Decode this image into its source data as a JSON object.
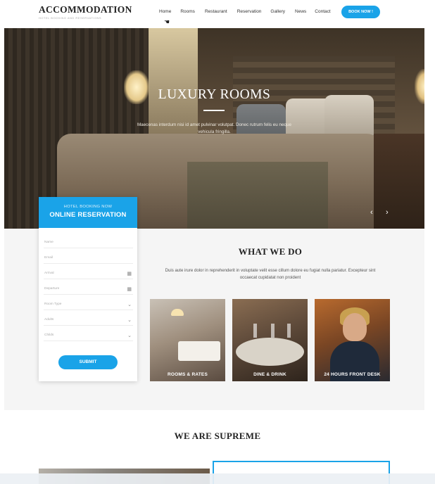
{
  "header": {
    "logo_title": "ACCOMMODATION",
    "logo_subtitle": "HOTEL BOOKING AND RESERVATIONS",
    "nav": [
      "Home",
      "Rooms",
      "Restaurant",
      "Reservation",
      "Gallery",
      "News",
      "Contact"
    ],
    "book_button": "BOOK NOW !"
  },
  "hero": {
    "title": "LUXURY ROOMS",
    "text": "Maecenas interdum nisi id amet pulvinar volutpat. Donec rutrum felis eu neque vehicula fringilla.",
    "prev_icon": "chevron-left-icon",
    "next_icon": "chevron-right-icon",
    "prev_glyph": "‹",
    "next_glyph": "›"
  },
  "booking": {
    "pretitle": "HOTEL BOOKING NOW",
    "title": "ONLINE RESERVATION",
    "fields": [
      "Name",
      "Email",
      "Arrival",
      "Departure",
      "Room Type",
      "Adults",
      "Childs"
    ],
    "submit": "SUBMIT"
  },
  "what_we_do": {
    "title": "WHAT WE DO",
    "text": "Duis aute irure dolor in reprehenderit in voluptate velit esse cillum dolore eu fugiat nulla pariatur. Excepteur sint occaecat cupidatat non proident",
    "cards": [
      "ROOMS & RATES",
      "DINE & DRINK",
      "24 HOURS FRONT DESK"
    ]
  },
  "supreme": {
    "title": "WE ARE SUPREME"
  },
  "colors": {
    "accent": "#1aa3e8",
    "section_bg": "#f5f5f5"
  }
}
